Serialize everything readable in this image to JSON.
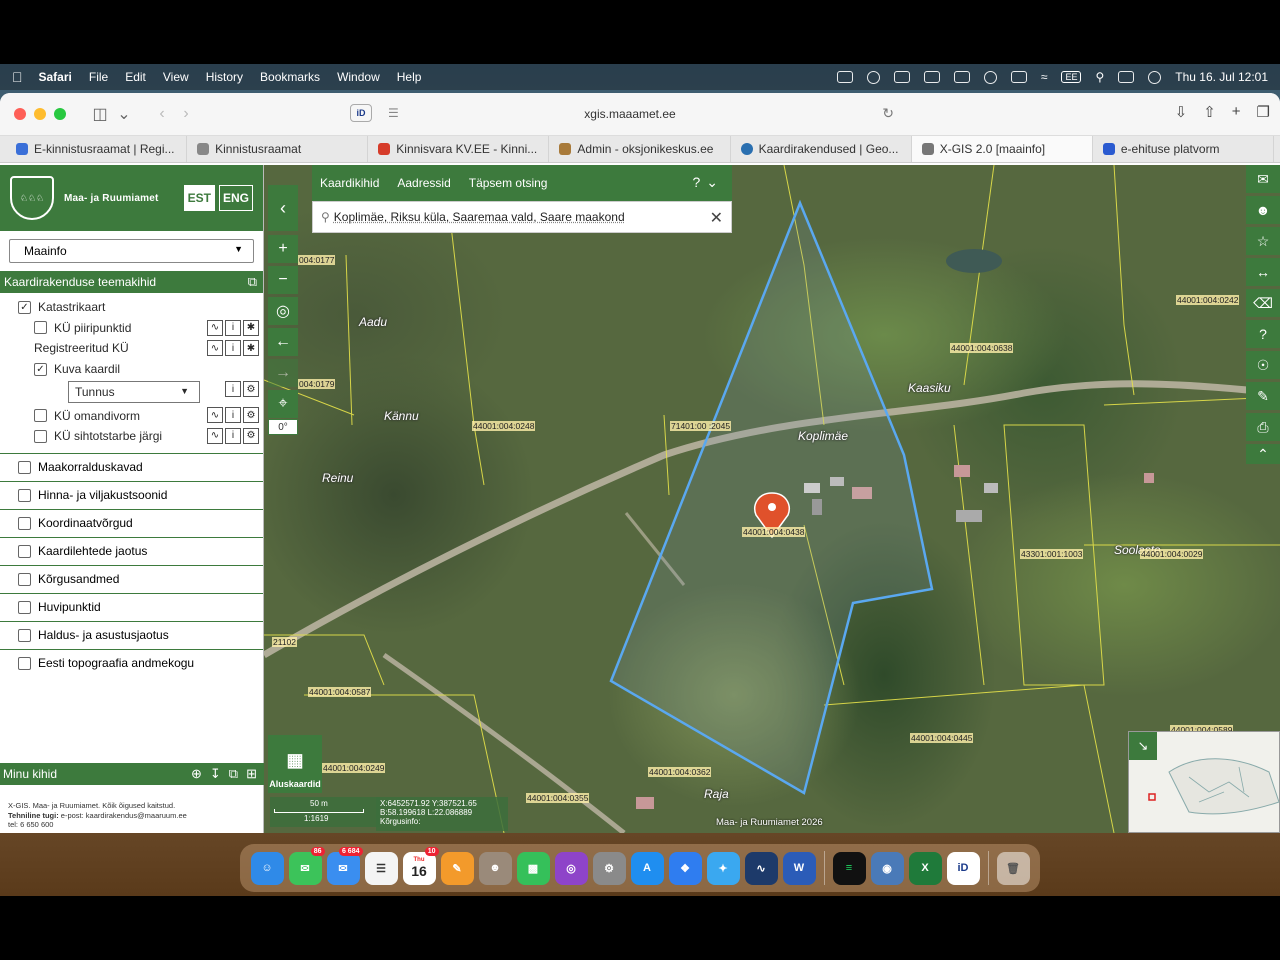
{
  "menubar": {
    "app": "Safari",
    "items": [
      "File",
      "Edit",
      "View",
      "History",
      "Bookmarks",
      "Window",
      "Help"
    ],
    "input_source": "EE",
    "clock": "Thu 16. Jul  12:01"
  },
  "browser": {
    "url": "xgis.maaamet.ee",
    "tabs": [
      {
        "label": "E-kinnistusraamat | Regi...",
        "color": "#3a6fd8"
      },
      {
        "label": "Kinnistusraamat",
        "color": "#888888"
      },
      {
        "label": "Kinnisvara KV.EE - Kinni...",
        "color": "#d63c2a"
      },
      {
        "label": "Admin - oksjonikeskus.ee",
        "color": "#a87a3a"
      },
      {
        "label": "Kaardirakendused | Geo...",
        "color": "#2a6fb0"
      },
      {
        "label": "X-GIS 2.0 [maainfo]",
        "color": "#777777",
        "active": true
      },
      {
        "label": "e-ehituse platvorm",
        "color": "#2a5ad0"
      }
    ]
  },
  "sidebar": {
    "brand": "Maa- ja Ruumiamet",
    "lang": [
      "EST",
      "ENG"
    ],
    "theme_select": "Maainfo",
    "section_title": "Kaardirakenduse teemakihid",
    "katastri": {
      "label": "Katastrikaart",
      "piiripunktid": "KÜ piiripunktid",
      "registreeritud": "Registreeritud KÜ",
      "kuva": "Kuva kaardil",
      "tunnus": "Tunnus",
      "omandivorm": "KÜ omandivorm",
      "sihtotstarve": "KÜ sihtotstarbe järgi"
    },
    "groups": [
      "Maakorralduskavad",
      "Hinna- ja viljakustsoonid",
      "Koordinaatvõrgud",
      "Kaardilehtede jaotus",
      "Kõrgusandmed",
      "Huvipunktid",
      "Haldus- ja asustusjaotus",
      "Eesti topograafia andmekogu"
    ],
    "my_layers": "Minu kihid",
    "footer": {
      "line1": "X-GIS. Maa- ja Ruumiamet. Kõik õigused kaitstud.",
      "line2_b": "Tehniline tugi:",
      "line2": " e-post: kaardirakendus@maaruum.ee",
      "line3": "tel: 6 650 600"
    }
  },
  "search": {
    "tabs": [
      "Kaardikihid",
      "Aadressid",
      "Täpsem otsing"
    ],
    "query": "Koplimäe, Riksu küla, Saaremaa vald, Saare maakond"
  },
  "map": {
    "compass": "0°",
    "basemaps": "Aluskaardid",
    "scale_dist": "50 m",
    "scale_ratio": "1:1619",
    "coord_xy": "X:6452571.92 Y:387521.65",
    "coord_bl": "B:58.199618 L:22.086889",
    "elev": "Kõrgusinfo:",
    "copyright": "Maa- ja Ruumiamet 2026",
    "places": [
      "Aadu",
      "Kännu",
      "Reinu",
      "Kaasiku",
      "Koplimäe",
      "Raja",
      "Soolaste"
    ],
    "parcels": [
      "004:0177",
      "004:0179",
      "44001:004:0248",
      "71401:00  :2045",
      "44001:004:0638",
      "44001:004:0242",
      "44001:004:0438",
      "43301:001:1003",
      "44001:004:0029",
      "21102",
      "44001:004:0587",
      "44001:004:0249",
      "44001:004:0362",
      "44001:004:0355",
      "44001:004:0445",
      "44001:004:0589"
    ],
    "boundary_color": "#5aa8f0"
  },
  "dock": {
    "messages_badge": "86",
    "mail_badge": "6 684",
    "calendar_day": "16",
    "calendar_badge": "10",
    "calendar_month": "Thu"
  }
}
